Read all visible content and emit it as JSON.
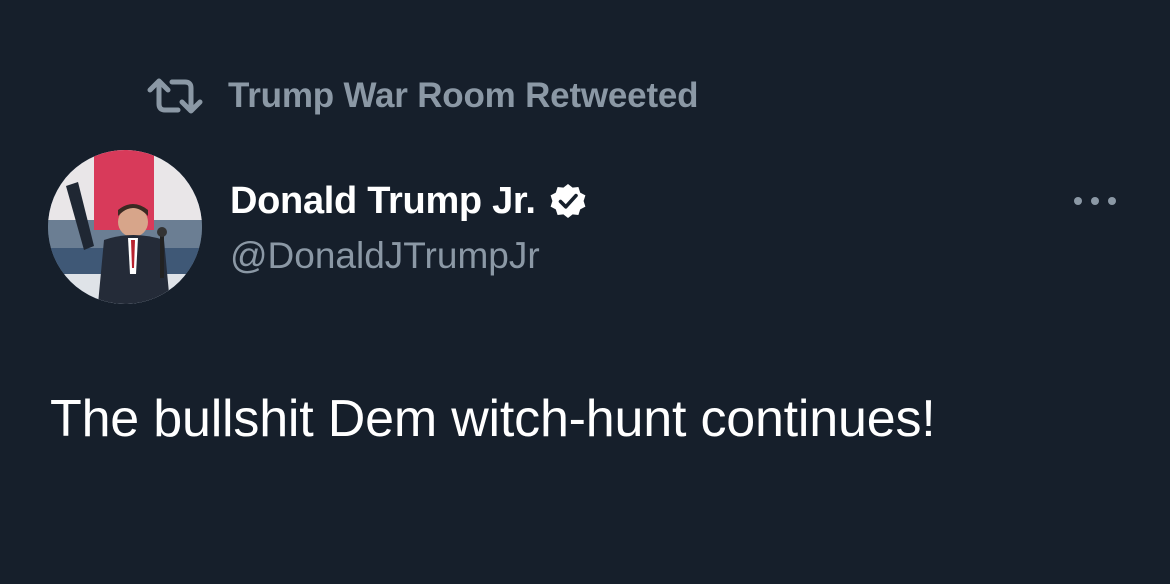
{
  "retweet_context": {
    "icon": "retweet-icon",
    "label": "Trump War Room Retweeted"
  },
  "author": {
    "display_name": "Donald Trump Jr.",
    "verified_icon": "verified-badge-icon",
    "handle": "@DonaldJTrumpJr"
  },
  "more_icon": "more-options-icon",
  "tweet": {
    "text": "The bullshit Dem witch-hunt continues!"
  },
  "colors": {
    "background": "#161f2b",
    "primary_text": "#ffffff",
    "secondary_text": "#8b98a5"
  }
}
